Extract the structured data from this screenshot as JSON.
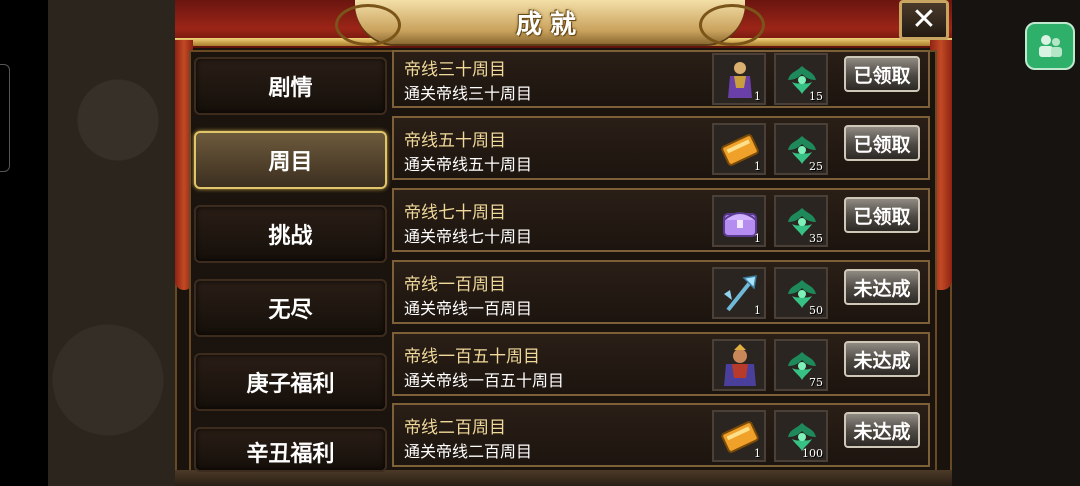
{
  "header": {
    "title": "成就",
    "close_symbol": "✕"
  },
  "categories": [
    {
      "label": "剧情",
      "active": false
    },
    {
      "label": "周目",
      "active": true
    },
    {
      "label": "挑战",
      "active": false
    },
    {
      "label": "无尽",
      "active": false
    },
    {
      "label": "庚子福利",
      "active": false
    },
    {
      "label": "辛丑福利",
      "active": false
    }
  ],
  "achievements": [
    {
      "title": "帝线三十周目",
      "desc": "通关帝线三十周目",
      "reward1": {
        "icon": "general-portrait-icon",
        "qty": "1"
      },
      "reward2": {
        "icon": "jade-herb-icon",
        "qty": "15"
      },
      "button": "已领取"
    },
    {
      "title": "帝线五十周目",
      "desc": "通关帝线五十周目",
      "reward1": {
        "icon": "gold-book-icon",
        "qty": "1"
      },
      "reward2": {
        "icon": "jade-herb-icon",
        "qty": "25"
      },
      "button": "已领取"
    },
    {
      "title": "帝线七十周目",
      "desc": "通关帝线七十周目",
      "reward1": {
        "icon": "purple-chest-icon",
        "qty": "1"
      },
      "reward2": {
        "icon": "jade-herb-icon",
        "qty": "35"
      },
      "button": "已领取"
    },
    {
      "title": "帝线一百周目",
      "desc": "通关帝线一百周目",
      "reward1": {
        "icon": "ice-halberd-icon",
        "qty": "1"
      },
      "reward2": {
        "icon": "jade-herb-icon",
        "qty": "50"
      },
      "button": "未达成"
    },
    {
      "title": "帝线一百五十周目",
      "desc": "通关帝线一百五十周目",
      "reward1": {
        "icon": "warlord-portrait-icon",
        "qty": ""
      },
      "reward2": {
        "icon": "jade-herb-icon",
        "qty": "75"
      },
      "button": "未达成"
    },
    {
      "title": "帝线二百周目",
      "desc": "通关帝线二百周目",
      "reward1": {
        "icon": "gold-book-icon",
        "qty": "1"
      },
      "reward2": {
        "icon": "jade-herb-icon",
        "qty": "100"
      },
      "button": "未达成"
    }
  ]
}
